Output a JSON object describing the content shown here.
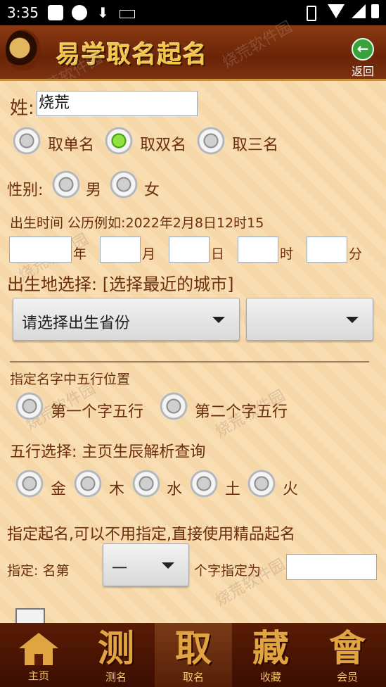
{
  "status_bar": {
    "time": "3:35"
  },
  "header": {
    "title": "易学取名起名",
    "back_label": "返回"
  },
  "form": {
    "surname_label": "姓:",
    "surname_value": "烧荒",
    "name_type_options": [
      "取单名",
      "取双名",
      "取三名"
    ],
    "name_type_selected": "取双名",
    "gender_label": "性别:",
    "gender_options": [
      "男",
      "女"
    ],
    "birth_time_label": "出生时间 公历例如:2022年2月8日12时15",
    "birth_units": [
      "年",
      "月",
      "日",
      "时",
      "分"
    ],
    "birthplace_label": "出生地选择:  [选择最近的城市]",
    "province_placeholder": "请选择出生省份",
    "city_value": "",
    "wuxing_position_label": "指定名字中五行位置",
    "wuxing_position_options": [
      "第一个字五行",
      "第二个字五行"
    ],
    "wuxing_select_label": "五行选择: 主页生辰解析查询",
    "wuxing_options": [
      "金",
      "木",
      "水",
      "土",
      "火"
    ],
    "specify_label": "指定起名,可以不用指定,直接使用精品起名",
    "specify_prefix": "指定: 名第",
    "specify_position_value": "一",
    "specify_suffix": "个字指定为",
    "specify_value": ""
  },
  "watermark": "烧荒软件园",
  "tabs": [
    {
      "glyph": "",
      "label": "主页",
      "icon": "home-icon"
    },
    {
      "glyph": "测",
      "label": "测名"
    },
    {
      "glyph": "取",
      "label": "取名"
    },
    {
      "glyph": "藏",
      "label": "收藏"
    },
    {
      "glyph": "會",
      "label": "会员"
    }
  ],
  "tab_active": "取名",
  "colors": {
    "text": "#6b2e0e",
    "header": "#6a2408",
    "title": "#f0c54a",
    "tabbar": "#3b0e02",
    "radio_on": "#8fe23c"
  }
}
